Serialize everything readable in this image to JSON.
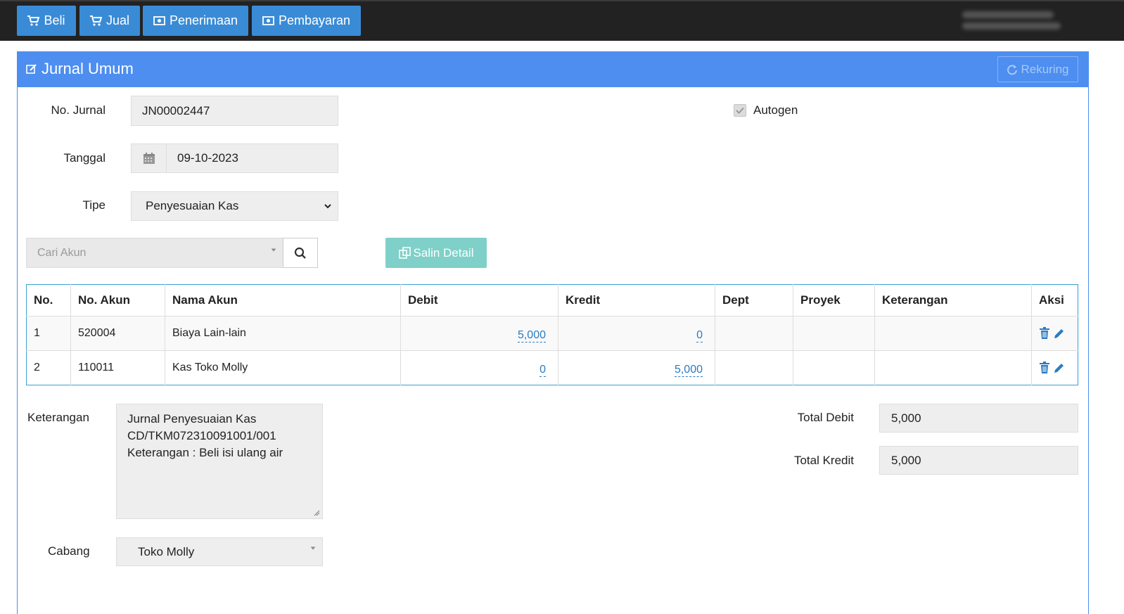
{
  "nav": {
    "beli": "Beli",
    "jual": "Jual",
    "penerimaan": "Penerimaan",
    "pembayaran": "Pembayaran"
  },
  "panel": {
    "title": "Jurnal Umum",
    "rekuring": "Rekuring"
  },
  "form": {
    "no_jurnal_label": "No. Jurnal",
    "no_jurnal_value": "JN00002447",
    "autogen_label": "Autogen",
    "tanggal_label": "Tanggal",
    "tanggal_value": "09-10-2023",
    "tipe_label": "Tipe",
    "tipe_value": "Penyesuaian Kas",
    "cari_akun_placeholder": "Cari Akun",
    "salin_detail": "Salin Detail"
  },
  "table": {
    "headers": [
      "No.",
      "No. Akun",
      "Nama Akun",
      "Debit",
      "Kredit",
      "Dept",
      "Proyek",
      "Keterangan",
      "Aksi"
    ],
    "rows": [
      {
        "no": "1",
        "akun": "520004",
        "nama": "Biaya Lain-lain",
        "debit": "5,000",
        "kredit": "0",
        "dept": "",
        "proyek": "",
        "keterangan": ""
      },
      {
        "no": "2",
        "akun": "110011",
        "nama": "Kas Toko Molly",
        "debit": "0",
        "kredit": "5,000",
        "dept": "",
        "proyek": "",
        "keterangan": ""
      }
    ]
  },
  "footer": {
    "keterangan_label": "Keterangan",
    "keterangan_line1": "Jurnal Penyesuaian Kas",
    "keterangan_line2": "CD/TKM072310091001/001",
    "keterangan_line3": "Keterangan : Beli isi ulang air",
    "cabang_label": "Cabang",
    "cabang_value": "Toko Molly",
    "total_debit_label": "Total Debit",
    "total_debit_value": "5,000",
    "total_kredit_label": "Total Kredit",
    "total_kredit_value": "5,000"
  },
  "colors": {
    "topbar": "#222222",
    "nav_button": "#3a8bd6",
    "panel_header": "#4d8ef0",
    "salin_button": "#7fd0c8",
    "link": "#2a7bc2"
  }
}
